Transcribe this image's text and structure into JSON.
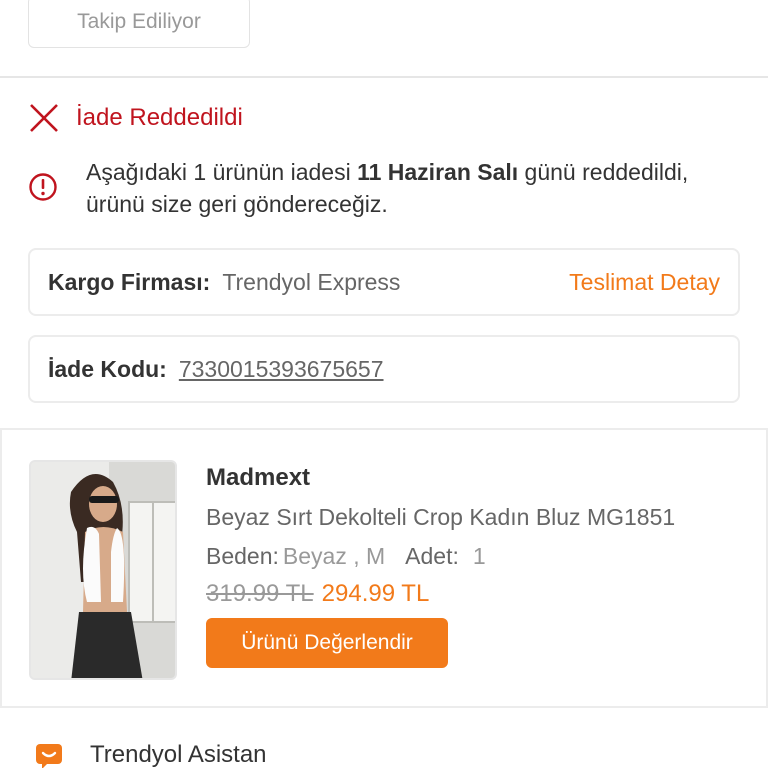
{
  "follow": {
    "label": "Takip Ediliyor"
  },
  "status": {
    "title": "İade Reddedildi",
    "message_part1": "Aşağıdaki 1 ürünün iadesi ",
    "message_date": "11 Haziran Salı",
    "message_part2": " günü reddedildi, ürünü size geri göndereceğiz."
  },
  "cargo": {
    "label": "Kargo Firması:",
    "value": "Trendyol Express",
    "link": "Teslimat Detay"
  },
  "return_code": {
    "label": "İade Kodu:",
    "value": "7330015393675657"
  },
  "product": {
    "brand": "Madmext",
    "name": "Beyaz Sırt Dekolteli Crop Kadın Bluz MG1851",
    "size_label": "Beden:",
    "size_value": "Beyaz , M",
    "qty_label": "Adet:",
    "qty_value": "1",
    "old_price": "319.99 TL",
    "new_price": "294.99 TL",
    "rate_button": "Ürünü Değerlendir"
  },
  "assistant": {
    "label": "Trendyol Asistan",
    "icon": "chat-bubble-icon"
  },
  "colors": {
    "accent": "#f27a1a",
    "error": "#c0141e"
  }
}
